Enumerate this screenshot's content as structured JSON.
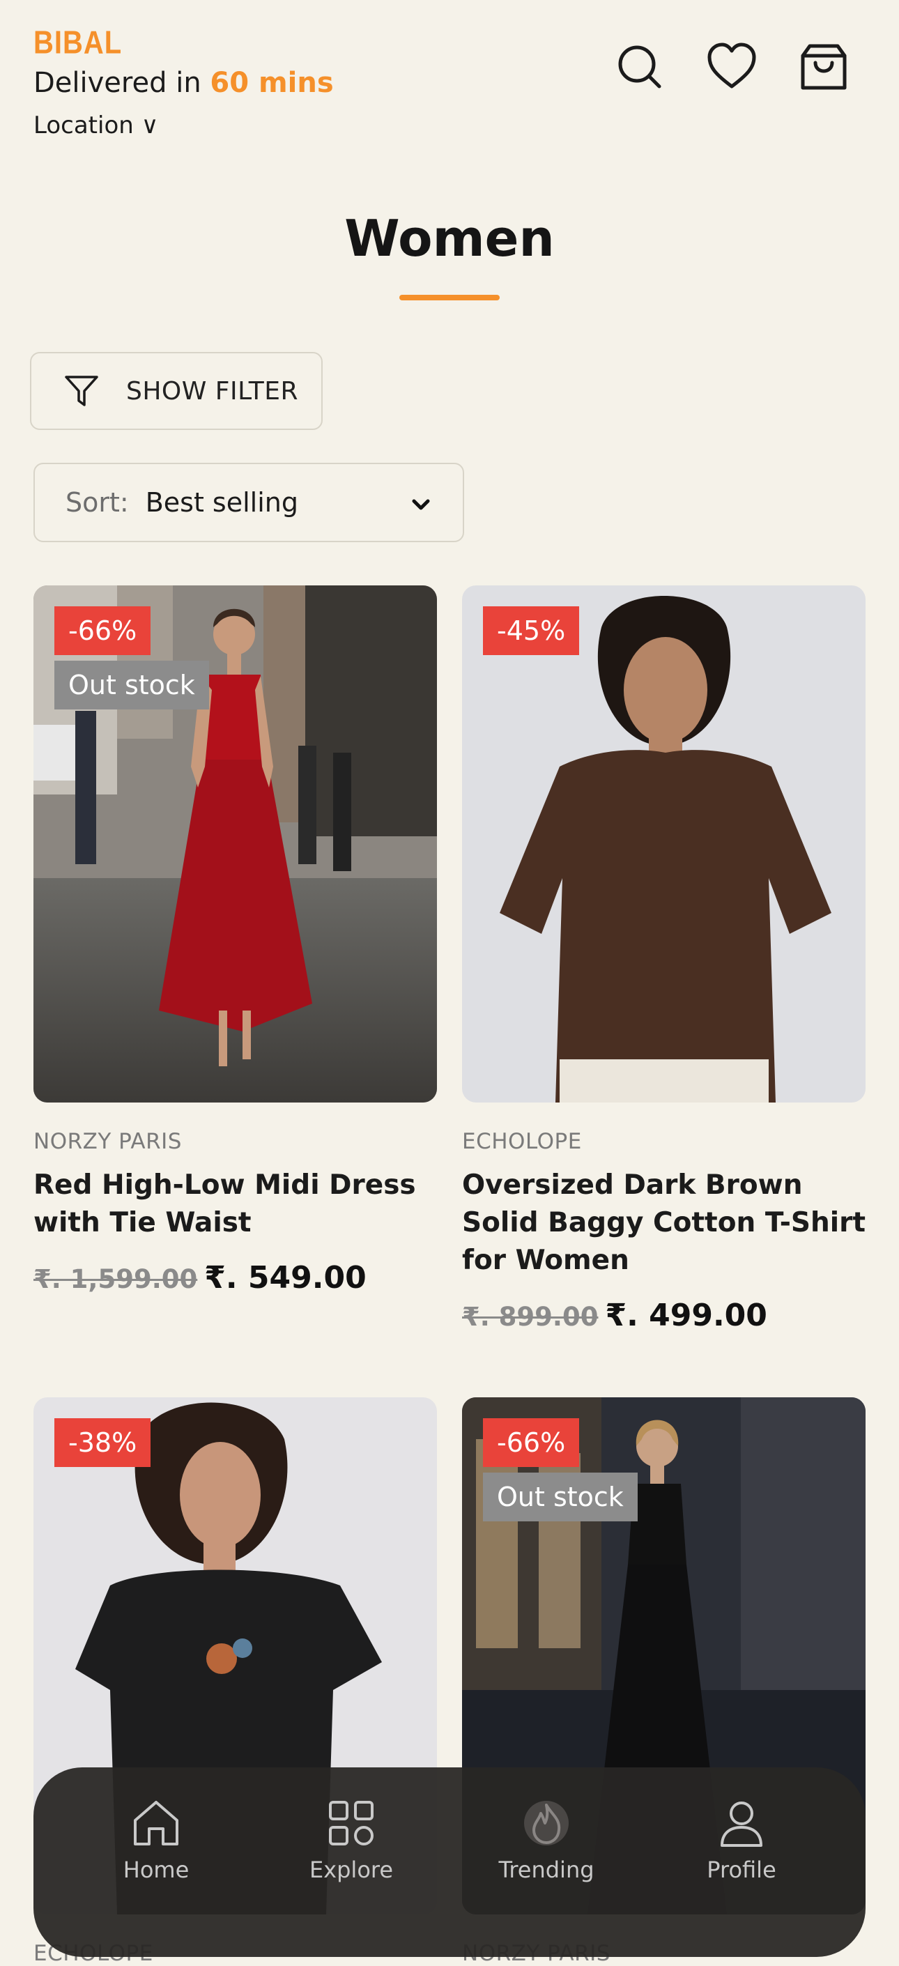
{
  "header": {
    "brand": "BIBAL",
    "delivery_prefix": "Delivered in ",
    "delivery_time": "60 mins",
    "location": "Location ∨",
    "icons": [
      "search-icon",
      "heart-icon",
      "shopping-bag-icon"
    ]
  },
  "page": {
    "title": "Women"
  },
  "filter": {
    "label": "SHOW FILTER"
  },
  "sort": {
    "label": "Sort:",
    "value": "Best selling"
  },
  "products": [
    {
      "discount": "-66%",
      "stock": "Out stock",
      "brand": "NORZY PARIS",
      "name": "Red High-Low Midi Dress with Tie Waist",
      "old_price": "₹. 1,599.00",
      "price": "₹. 549.00"
    },
    {
      "discount": "-45%",
      "brand": "ECHOLOPE",
      "name": "Oversized Dark Brown Solid Baggy Cotton T-Shirt for Women",
      "old_price": "₹. 899.00",
      "price": "₹. 499.00"
    },
    {
      "discount": "-38%",
      "brand": "ECHOLOPE"
    },
    {
      "discount": "-66%",
      "stock": "Out stock",
      "brand": "NORZY PARIS"
    }
  ],
  "nav": [
    {
      "label": "Home",
      "icon": "home-icon"
    },
    {
      "label": "Explore",
      "icon": "grid-icon"
    },
    {
      "label": "Trending",
      "icon": "flame-icon"
    },
    {
      "label": "Profile",
      "icon": "user-icon"
    }
  ],
  "colors": {
    "background": "#f5f2e9",
    "accent": "#f5902a",
    "discount_badge": "#e9433a",
    "out_of_stock_badge": "#8c8c8c",
    "nav_background": "#282624"
  }
}
